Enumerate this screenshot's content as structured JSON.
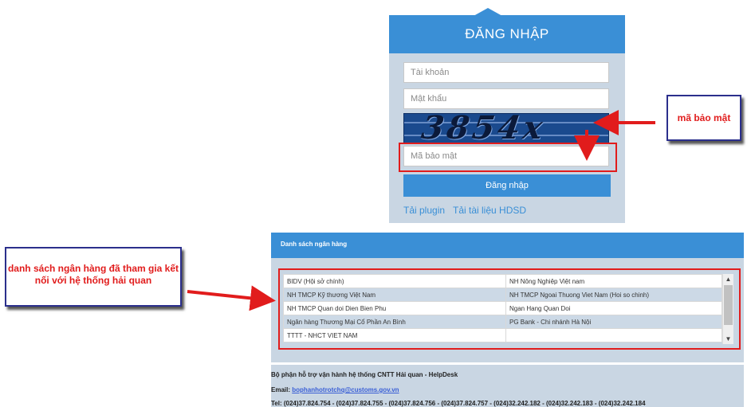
{
  "login": {
    "title": "ĐĂNG NHẬP",
    "username_placeholder": "Tài khoản",
    "password_placeholder": "Mật khẩu",
    "captcha_image_text": "3854x",
    "captcha_placeholder": "Mã bảo mật",
    "submit_label": "Đăng nhập",
    "link_plugin": "Tải plugin",
    "link_docs": "Tải tài liệu HDSD"
  },
  "annotations": {
    "captcha_callout": "mã bảo mật",
    "bank_callout": "danh sách ngân hàng đã tham gia kết nối với hệ thống hải quan",
    "accent_color": "#e11c1c"
  },
  "banks": {
    "header": "Danh sách ngân hàng",
    "rows": [
      [
        "BIDV (Hội sở chính)",
        "NH Nông Nghiệp Việt nam"
      ],
      [
        "NH TMCP Kỹ thương Việt Nam",
        "NH TMCP Ngoai Thuong Viet Nam (Hoi so chinh)"
      ],
      [
        "NH TMCP Quan doi Dien Bien Phu",
        "Ngan Hang Quan Doi"
      ],
      [
        "Ngân hàng Thương Mại Cổ Phần An Bình",
        "PG Bank - Chi nhánh Hà Nội"
      ],
      [
        "TTTT - NHCT VIET NAM",
        ""
      ]
    ]
  },
  "footer": {
    "helpdesk": "Bộ phận hỗ trợ vận hành hệ thống CNTT Hải quan - HelpDesk",
    "email_label": "Email:",
    "email": "bophanhotrotchq@customs.gov.vn",
    "tel": "Tel: (024)37.824.754 - (024)37.824.755 - (024)37.824.756 - (024)37.824.757 - (024)32.242.182 - (024)32.242.183 - (024)32.242.184"
  },
  "colors": {
    "primary": "#3a8fd6",
    "panel": "#c9d6e3"
  }
}
